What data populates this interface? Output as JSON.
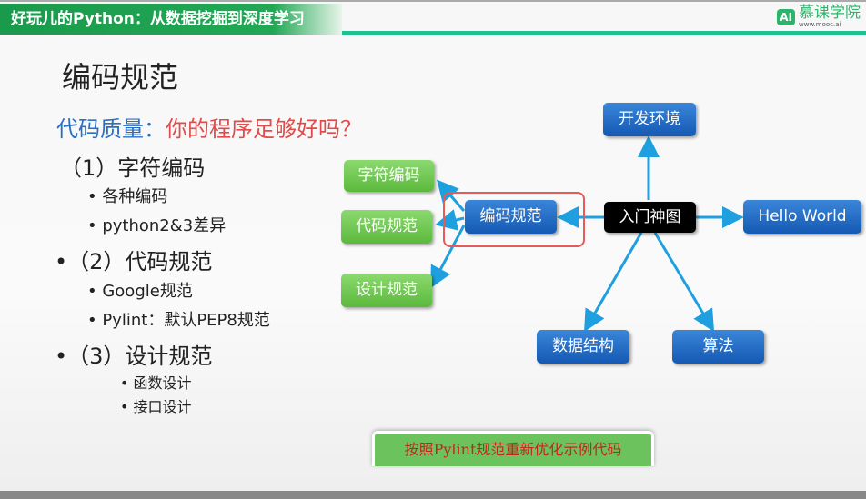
{
  "header": {
    "course_title": "好玩儿的Python：从数据挖掘到深度学习",
    "logo_badge": "AI",
    "logo_name": "慕课学院",
    "logo_url": "www.mooc.ai"
  },
  "slide": {
    "title": "编码规范",
    "subtitle_label": "代码质量：",
    "subtitle_question": "你的程序足够好吗？",
    "items": [
      "（1）字符编码",
      "各种编码",
      "python2&3差异",
      "•（2）代码规范",
      "Google规范",
      "Pylint：默认PEP8规范",
      "•（3）设计规范",
      "函数设计",
      "接口设计"
    ]
  },
  "diagram": {
    "center": "入门神图",
    "top": "开发环境",
    "right": "Hello World",
    "left": "编码规范",
    "bottom_left": "数据结构",
    "bottom_right": "算法",
    "sub": [
      "字符编码",
      "代码规范",
      "设计规范"
    ]
  },
  "action_button": "按照Pylint规范重新优化示例代码",
  "colors": {
    "banner": "#22a855",
    "node_blue": "#1b63be",
    "node_green": "#6cc850",
    "arrow": "#1ea0e0",
    "highlight": "#e65a5a",
    "question": "#e04b4b",
    "label_blue": "#2b6fc4"
  }
}
